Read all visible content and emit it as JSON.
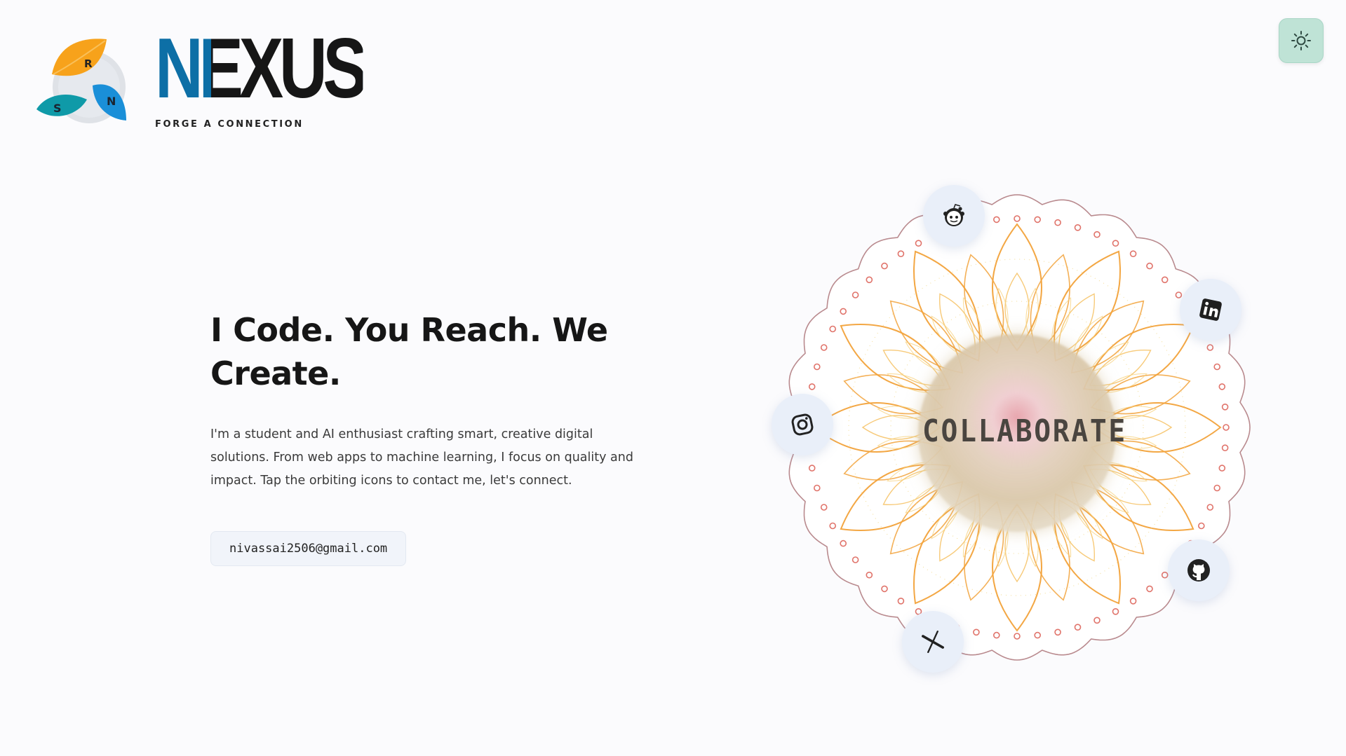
{
  "brand": {
    "name": "NEXUS",
    "tagline": "FORGE A CONNECTION",
    "logo_letters": [
      "R",
      "S",
      "N"
    ]
  },
  "theme_toggle": {
    "icon": "sun-icon"
  },
  "hero": {
    "title": "I Code. You Reach. We Create.",
    "body": "I'm a student and AI enthusiast crafting smart, creative digital solutions. From web apps to machine learning, I focus on quality and impact. Tap the orbiting icons to contact me, let's connect.",
    "email": "nivassai2506@gmail.com"
  },
  "mandala": {
    "center_label": "COLLABORATE",
    "orbit_icons": [
      {
        "name": "reddit-icon"
      },
      {
        "name": "linkedin-icon"
      },
      {
        "name": "instagram-icon"
      },
      {
        "name": "github-icon"
      },
      {
        "name": "x-icon"
      }
    ]
  },
  "colors": {
    "brand_blue": "#0d6fa6",
    "petal_orange": "#f7a21b",
    "petal_teal": "#0f9aa8",
    "petal_blue": "#1a8fd8",
    "mandala_orange": "#f2a23a",
    "mandala_ring": "#e0736a",
    "toggle_bg": "#bfe3d6"
  }
}
